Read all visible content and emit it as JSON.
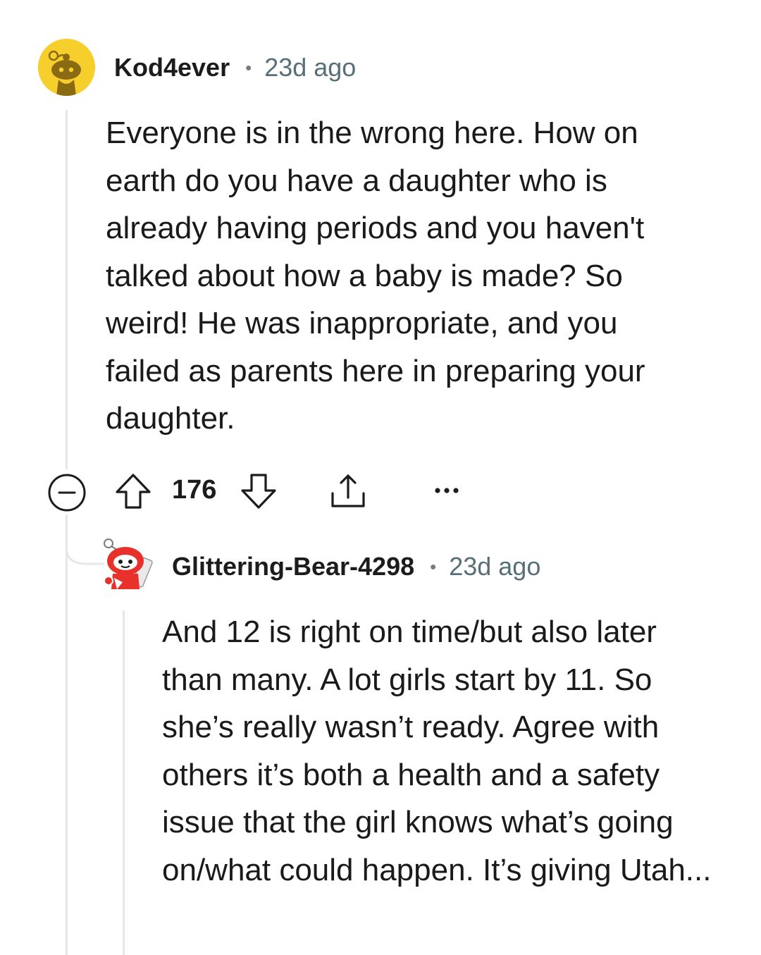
{
  "comments": [
    {
      "username": "Kod4ever",
      "separator": "•",
      "time": "23d ago",
      "avatar_icon": "snoo-avatar-yellow-icon",
      "avatar_bg": "#f6cf2d",
      "text": "Everyone is in the wrong here. How on earth do you have a daughter who is already having periods and you haven't talked about how a baby is made? So weird! He was inappropriate, and you failed as parents here in preparing your daughter.",
      "score": "176"
    },
    {
      "username": "Glittering-Bear-4298",
      "separator": "•",
      "time": "23d ago",
      "avatar_icon": "snoo-avatar-red-icon",
      "avatar_bg": "#e8312b",
      "text": "And 12 is right on time/but also later than many. A lot girls start by 11. So she’s really wasn’t ready. Agree with others it’s both a health and a safety issue that the girl knows what’s going on/what could happen. It’s giving Utah..."
    }
  ],
  "actions": {
    "collapse_icon": "collapse-minus-icon",
    "upvote_icon": "upvote-arrow-icon",
    "downvote_icon": "downvote-arrow-icon",
    "share_icon": "share-icon",
    "more_icon": "more-options-icon"
  },
  "colors": {
    "meta_gray": "#576f76",
    "thread_line": "#e6e7e8"
  }
}
